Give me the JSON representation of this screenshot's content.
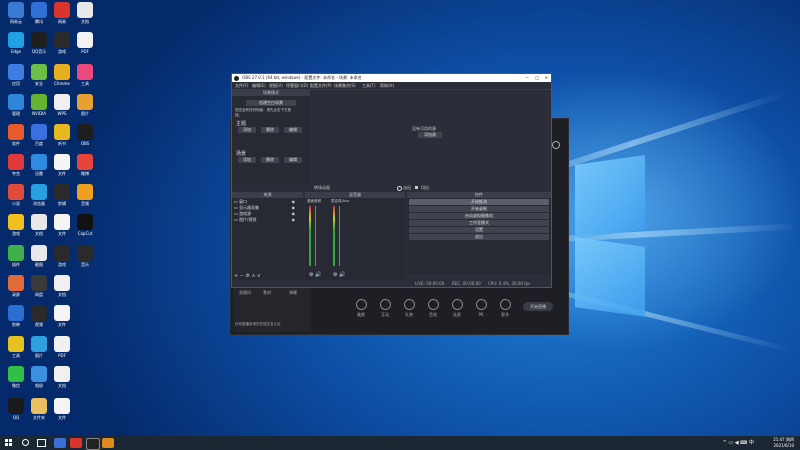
{
  "desktop_icons": [
    {
      "label": "网易云",
      "color": "#3a7bd5"
    },
    {
      "label": "腾讯",
      "color": "#2f6fd6"
    },
    {
      "label": "网易",
      "color": "#d9352a"
    },
    {
      "label": "文档",
      "color": "#e8e8e8"
    },
    {
      "label": "Edge",
      "color": "#1fa1e3"
    },
    {
      "label": "QQ音乐",
      "color": "#1f1f1f"
    },
    {
      "label": "游戏",
      "color": "#2a2a2a"
    },
    {
      "label": "PDF",
      "color": "#f2f2f2"
    },
    {
      "label": "应用",
      "color": "#3d7ce0"
    },
    {
      "label": "安全",
      "color": "#6ac046"
    },
    {
      "label": "Chrome",
      "color": "#e8b020"
    },
    {
      "label": "工具",
      "color": "#e84a7d"
    },
    {
      "label": "管理",
      "color": "#2d86d9"
    },
    {
      "label": "NVIDIA",
      "color": "#65b32e"
    },
    {
      "label": "WPS",
      "color": "#f0f0f0"
    },
    {
      "label": "图片",
      "color": "#e8a030"
    },
    {
      "label": "软件",
      "color": "#e85a2a"
    },
    {
      "label": "百度",
      "color": "#3a6fe0"
    },
    {
      "label": "听书",
      "color": "#e8b820"
    },
    {
      "label": "OBS",
      "color": "#1e1e1e"
    },
    {
      "label": "夸克",
      "color": "#e0393a"
    },
    {
      "label": "迅雷",
      "color": "#2e8be0"
    },
    {
      "label": "文件",
      "color": "#f5f5f5"
    },
    {
      "label": "微博",
      "color": "#e8443a"
    },
    {
      "label": "小说",
      "color": "#e04a3a"
    },
    {
      "label": "浏览器",
      "color": "#28a0e0"
    },
    {
      "label": "剪辑",
      "color": "#2b2b2b"
    },
    {
      "label": "音频",
      "color": "#f0a020"
    },
    {
      "label": "游戏",
      "color": "#f0c020"
    },
    {
      "label": "文档",
      "color": "#e8e8e8"
    },
    {
      "label": "文件",
      "color": "#f5f5f5"
    },
    {
      "label": "CapCut",
      "color": "#111111"
    },
    {
      "label": "插件",
      "color": "#3fb04a"
    },
    {
      "label": "截图",
      "color": "#e8e8e8"
    },
    {
      "label": "游戏",
      "color": "#2a2a2a"
    },
    {
      "label": "音乐",
      "color": "#2a2a2a"
    },
    {
      "label": "录屏",
      "color": "#e06a3a"
    },
    {
      "label": "网盘",
      "color": "#3a3a3a"
    },
    {
      "label": "文档",
      "color": "#f0f0f0"
    },
    {
      "label": "剪映",
      "color": "#2a6fd0"
    },
    {
      "label": "视频",
      "color": "#2a2a2a"
    },
    {
      "label": "文件",
      "color": "#f5f5f5"
    },
    {
      "label": "工具",
      "color": "#e8c020"
    },
    {
      "label": "图片",
      "color": "#2ea0e0"
    },
    {
      "label": "PDF",
      "color": "#f0f0f0"
    },
    {
      "label": "微信",
      "color": "#30c048"
    },
    {
      "label": "相册",
      "color": "#3a8fe0"
    },
    {
      "label": "文档",
      "color": "#f0f0f0"
    },
    {
      "label": "QQ",
      "color": "#1a1a1a"
    },
    {
      "label": "文件夹",
      "color": "#e8c060"
    },
    {
      "label": "文件",
      "color": "#f5f5f5"
    },
    {
      "label": "直播",
      "color": "#2a8fe0"
    },
    {
      "label": "网易",
      "color": "#e03a3a"
    },
    {
      "label": "助手",
      "color": "#2e7fd8"
    }
  ],
  "back_window": {
    "buttons": [
      "美颜",
      "互动",
      "礼物",
      "音效",
      "连麦",
      "PK",
      "更多"
    ],
    "action_button": "开始直播",
    "left_items": [
      "直播间",
      "素材",
      "弹幕"
    ],
    "notice": "在你直播前请先完成实名认证"
  },
  "obs": {
    "title": "OBS 27.0.1 (64 bit, windows) - 配置文件: 未命名 - 场景: 未命名",
    "menus": [
      "文件(F)",
      "编辑(E)",
      "视图(V)",
      "停靠窗口(D)",
      "配置文件(P)",
      "场景集合(S)",
      "工具(T)",
      "帮助(H)"
    ],
    "scene_panel": {
      "title": "场景模式",
      "template_button": "创建空白场景",
      "hint": "您还没有任何场景，请先点击下方按钮。",
      "group1": "主题",
      "group2": "场景",
      "btns": [
        "添加",
        "删除",
        "编辑"
      ]
    },
    "preview": {
      "line1": "没有可用的源",
      "line2": "添加源"
    },
    "transition_bar": {
      "label": "转场动画",
      "opt1": "淡出",
      "opt2": "切出"
    },
    "sources": {
      "title": "来源",
      "items": [
        "窗口",
        "显示器采集",
        "游戏源",
        "图片/视频"
      ]
    },
    "mixer": {
      "title": "混音器",
      "ch1": "桌面音频",
      "ch2": "麦克风/Aux"
    },
    "controls": {
      "title": "控件",
      "items": [
        "开始推流",
        "开始录制",
        "启动虚拟摄像机",
        "工作室模式",
        "设置",
        "退出"
      ]
    },
    "status": {
      "live": "LIVE: 00:00:00",
      "rec": "REC: 00:00:00",
      "cpu": "CPU: 0.4%, 30.00 fps"
    }
  },
  "taskbar": {
    "time": "21:47 周四",
    "date": "2021/6/10"
  }
}
